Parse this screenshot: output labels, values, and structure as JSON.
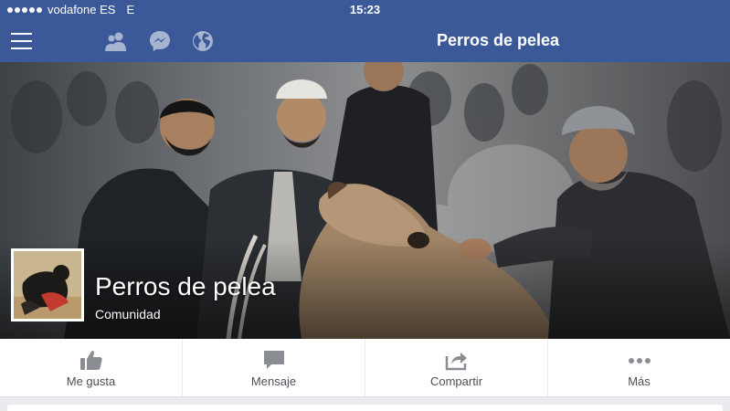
{
  "status_bar": {
    "carrier": "vodafone ES",
    "network": "E",
    "time": "15:23"
  },
  "nav": {
    "title": "Perros de pelea",
    "icons": [
      "menu-icon",
      "friends-icon",
      "messenger-icon",
      "globe-icon"
    ]
  },
  "page": {
    "name": "Perros de pelea",
    "category": "Comunidad"
  },
  "actions": [
    {
      "label": "Me gusta",
      "icon": "thumbs-up-icon"
    },
    {
      "label": "Mensaje",
      "icon": "message-icon"
    },
    {
      "label": "Compartir",
      "icon": "share-icon"
    },
    {
      "label": "Más",
      "icon": "more-icon"
    }
  ],
  "colors": {
    "brand": "#3b5998",
    "icon_gray": "#8a8d91",
    "label_gray": "#4b4f56"
  }
}
